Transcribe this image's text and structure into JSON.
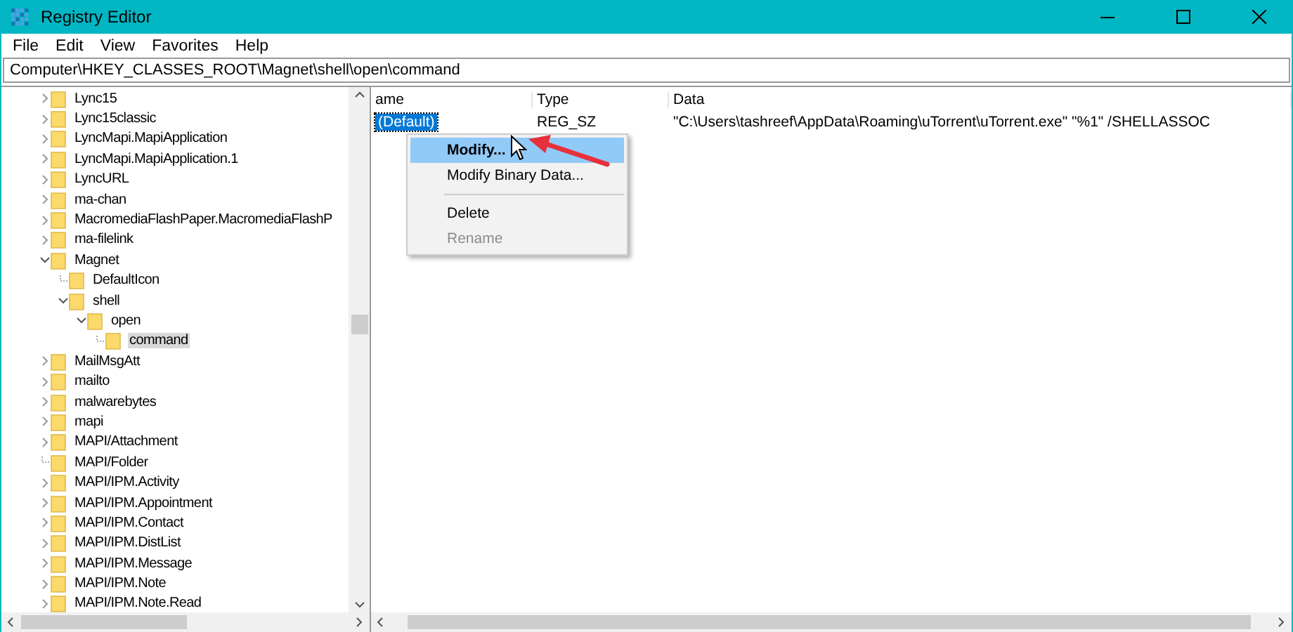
{
  "window": {
    "title": "Registry Editor"
  },
  "menu": [
    "File",
    "Edit",
    "View",
    "Favorites",
    "Help"
  ],
  "address": "Computer\\HKEY_CLASSES_ROOT\\Magnet\\shell\\open\\command",
  "tree": [
    {
      "label": "Lync15",
      "kind": "branch",
      "expanded": false,
      "selected": false
    },
    {
      "label": "Lync15classic",
      "kind": "branch",
      "expanded": false,
      "selected": false
    },
    {
      "label": "LyncMapi.MapiApplication",
      "kind": "branch",
      "expanded": false,
      "selected": false
    },
    {
      "label": "LyncMapi.MapiApplication.1",
      "kind": "branch",
      "expanded": false,
      "selected": false
    },
    {
      "label": "LyncURL",
      "kind": "branch",
      "expanded": false,
      "selected": false
    },
    {
      "label": "ma-chan",
      "kind": "branch",
      "expanded": false,
      "selected": false
    },
    {
      "label": "MacromediaFlashPaper.MacromediaFlashP",
      "kind": "branch",
      "expanded": false,
      "selected": false
    },
    {
      "label": "ma-filelink",
      "kind": "branch",
      "expanded": false,
      "selected": false
    },
    {
      "label": "Magnet",
      "kind": "branch",
      "expanded": true,
      "selected": false,
      "children": [
        {
          "label": "DefaultIcon",
          "kind": "leaf",
          "selected": false
        },
        {
          "label": "shell",
          "kind": "branch",
          "expanded": true,
          "selected": false,
          "children": [
            {
              "label": "open",
              "kind": "branch",
              "expanded": true,
              "selected": false,
              "children": [
                {
                  "label": "command",
                  "kind": "leaf",
                  "selected": true
                }
              ]
            }
          ]
        }
      ]
    },
    {
      "label": "MailMsgAtt",
      "kind": "branch",
      "expanded": false,
      "selected": false
    },
    {
      "label": "mailto",
      "kind": "branch",
      "expanded": false,
      "selected": false
    },
    {
      "label": "malwarebytes",
      "kind": "branch",
      "expanded": false,
      "selected": false
    },
    {
      "label": "mapi",
      "kind": "branch",
      "expanded": false,
      "selected": false
    },
    {
      "label": "MAPI/Attachment",
      "kind": "branch",
      "expanded": false,
      "selected": false
    },
    {
      "label": "MAPI/Folder",
      "kind": "leaf",
      "selected": false
    },
    {
      "label": "MAPI/IPM.Activity",
      "kind": "branch",
      "expanded": false,
      "selected": false
    },
    {
      "label": "MAPI/IPM.Appointment",
      "kind": "branch",
      "expanded": false,
      "selected": false
    },
    {
      "label": "MAPI/IPM.Contact",
      "kind": "branch",
      "expanded": false,
      "selected": false
    },
    {
      "label": "MAPI/IPM.DistList",
      "kind": "branch",
      "expanded": false,
      "selected": false
    },
    {
      "label": "MAPI/IPM.Message",
      "kind": "branch",
      "expanded": false,
      "selected": false
    },
    {
      "label": "MAPI/IPM.Note",
      "kind": "branch",
      "expanded": false,
      "selected": false
    },
    {
      "label": "MAPI/IPM.Note.Read",
      "kind": "branch",
      "expanded": false,
      "selected": false
    }
  ],
  "table": {
    "columns": [
      "ame",
      "Type",
      "Data"
    ],
    "rows": [
      {
        "name": "(Default)",
        "type": "REG_SZ",
        "data": "\"C:\\Users\\tashreef\\AppData\\Roaming\\uTorrent\\uTorrent.exe\" \"%1\" /SHELLASSOC",
        "selected": true
      }
    ]
  },
  "context_menu": [
    {
      "kind": "item",
      "label": "Modify...",
      "selected": true,
      "disabled": false
    },
    {
      "kind": "item",
      "label": "Modify Binary Data...",
      "selected": false,
      "disabled": false
    },
    {
      "kind": "separator"
    },
    {
      "kind": "item",
      "label": "Delete",
      "selected": false,
      "disabled": false
    },
    {
      "kind": "item",
      "label": "Rename",
      "selected": false,
      "disabled": true
    }
  ]
}
